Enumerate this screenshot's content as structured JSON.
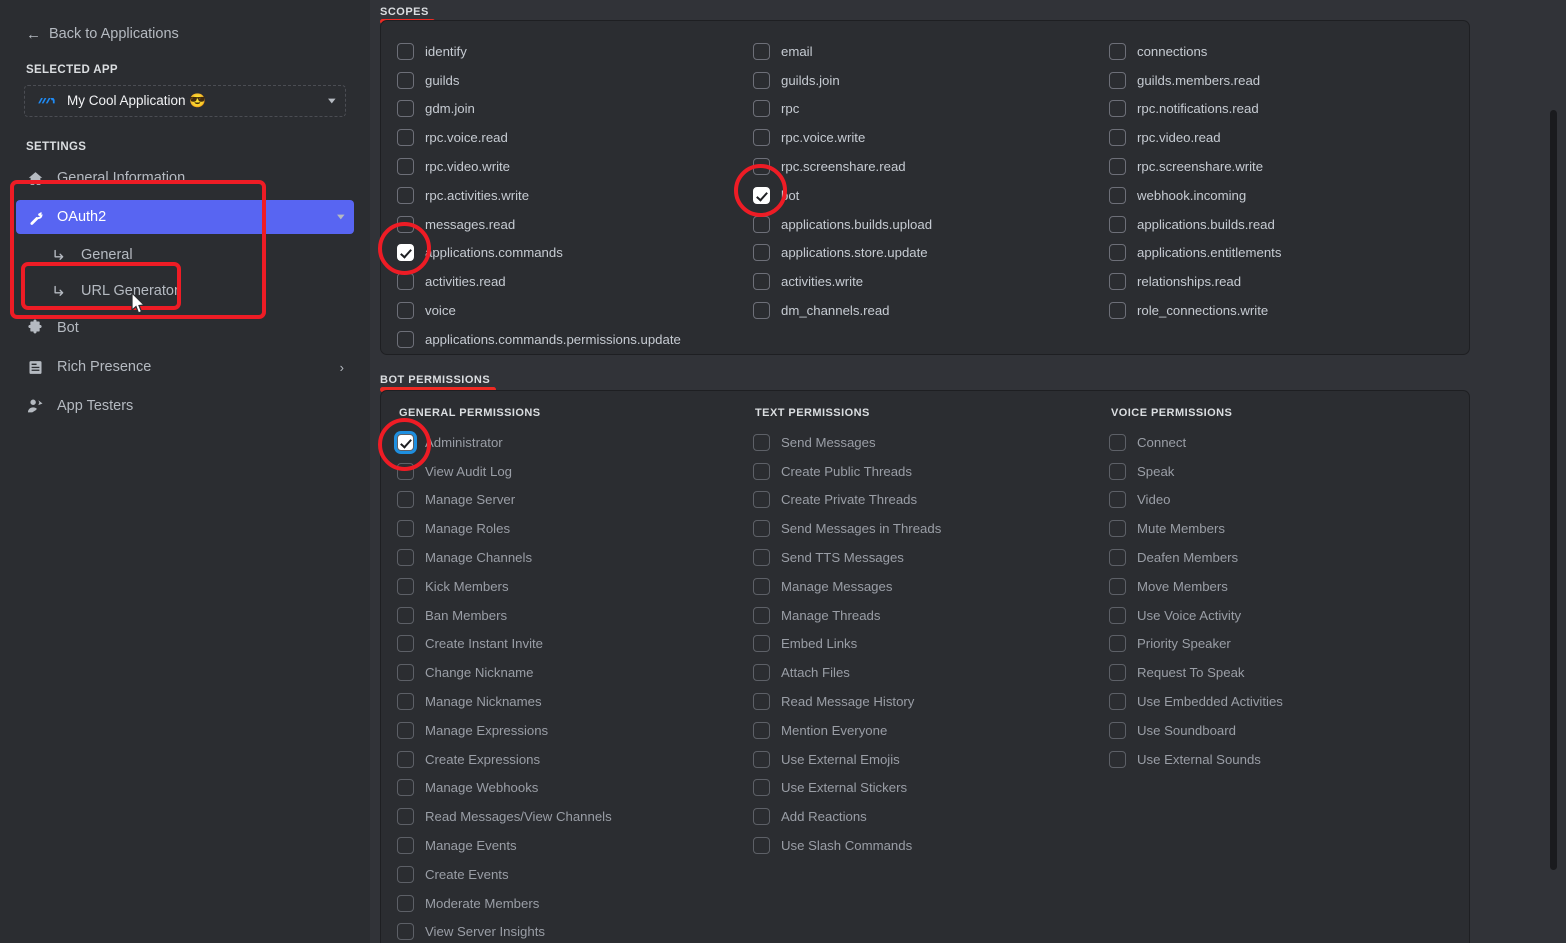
{
  "sidebar": {
    "back_label": "Back to Applications",
    "selected_app_label": "SELECTED APP",
    "app_name": "My Cool Application 😎",
    "settings_label": "SETTINGS",
    "items": [
      {
        "label": "General Information",
        "icon": "home-icon",
        "active": false,
        "has_chevron": false
      },
      {
        "label": "OAuth2",
        "icon": "wrench-icon",
        "active": true,
        "has_chevron": true
      },
      {
        "label": "Bot",
        "icon": "puzzle-icon",
        "active": false,
        "has_chevron": false
      },
      {
        "label": "Rich Presence",
        "icon": "document-icon",
        "active": false,
        "has_chevron": true
      },
      {
        "label": "App Testers",
        "icon": "person-add-icon",
        "active": false,
        "has_chevron": false
      }
    ],
    "oauth_children": [
      {
        "label": "General",
        "icon": "arrow-branch-icon"
      },
      {
        "label": "URL Generator",
        "icon": "arrow-branch-icon"
      }
    ]
  },
  "scopes": {
    "heading": "SCOPES",
    "columns": [
      [
        {
          "label": "identify",
          "checked": false
        },
        {
          "label": "guilds",
          "checked": false
        },
        {
          "label": "gdm.join",
          "checked": false
        },
        {
          "label": "rpc.voice.read",
          "checked": false
        },
        {
          "label": "rpc.video.write",
          "checked": false
        },
        {
          "label": "rpc.activities.write",
          "checked": false
        },
        {
          "label": "messages.read",
          "checked": false
        },
        {
          "label": "applications.commands",
          "checked": true
        },
        {
          "label": "activities.read",
          "checked": false
        },
        {
          "label": "voice",
          "checked": false
        },
        {
          "label": "applications.commands.permissions.update",
          "checked": false
        }
      ],
      [
        {
          "label": "email",
          "checked": false
        },
        {
          "label": "guilds.join",
          "checked": false
        },
        {
          "label": "rpc",
          "checked": false
        },
        {
          "label": "rpc.voice.write",
          "checked": false
        },
        {
          "label": "rpc.screenshare.read",
          "checked": false
        },
        {
          "label": "bot",
          "checked": true
        },
        {
          "label": "applications.builds.upload",
          "checked": false
        },
        {
          "label": "applications.store.update",
          "checked": false
        },
        {
          "label": "activities.write",
          "checked": false
        },
        {
          "label": "dm_channels.read",
          "checked": false
        }
      ],
      [
        {
          "label": "connections",
          "checked": false
        },
        {
          "label": "guilds.members.read",
          "checked": false
        },
        {
          "label": "rpc.notifications.read",
          "checked": false
        },
        {
          "label": "rpc.video.read",
          "checked": false
        },
        {
          "label": "rpc.screenshare.write",
          "checked": false
        },
        {
          "label": "webhook.incoming",
          "checked": false
        },
        {
          "label": "applications.builds.read",
          "checked": false
        },
        {
          "label": "applications.entitlements",
          "checked": false
        },
        {
          "label": "relationships.read",
          "checked": false
        },
        {
          "label": "role_connections.write",
          "checked": false
        }
      ]
    ]
  },
  "bot_permissions": {
    "heading": "BOT PERMISSIONS",
    "groups": [
      {
        "title": "GENERAL PERMISSIONS",
        "items": [
          {
            "label": "Administrator",
            "checked": true,
            "focused": true
          },
          {
            "label": "View Audit Log",
            "checked": false
          },
          {
            "label": "Manage Server",
            "checked": false
          },
          {
            "label": "Manage Roles",
            "checked": false
          },
          {
            "label": "Manage Channels",
            "checked": false
          },
          {
            "label": "Kick Members",
            "checked": false
          },
          {
            "label": "Ban Members",
            "checked": false
          },
          {
            "label": "Create Instant Invite",
            "checked": false
          },
          {
            "label": "Change Nickname",
            "checked": false
          },
          {
            "label": "Manage Nicknames",
            "checked": false
          },
          {
            "label": "Manage Expressions",
            "checked": false
          },
          {
            "label": "Create Expressions",
            "checked": false
          },
          {
            "label": "Manage Webhooks",
            "checked": false
          },
          {
            "label": "Read Messages/View Channels",
            "checked": false
          },
          {
            "label": "Manage Events",
            "checked": false
          },
          {
            "label": "Create Events",
            "checked": false
          },
          {
            "label": "Moderate Members",
            "checked": false
          },
          {
            "label": "View Server Insights",
            "checked": false
          }
        ]
      },
      {
        "title": "TEXT PERMISSIONS",
        "items": [
          {
            "label": "Send Messages",
            "checked": false
          },
          {
            "label": "Create Public Threads",
            "checked": false
          },
          {
            "label": "Create Private Threads",
            "checked": false
          },
          {
            "label": "Send Messages in Threads",
            "checked": false
          },
          {
            "label": "Send TTS Messages",
            "checked": false
          },
          {
            "label": "Manage Messages",
            "checked": false
          },
          {
            "label": "Manage Threads",
            "checked": false
          },
          {
            "label": "Embed Links",
            "checked": false
          },
          {
            "label": "Attach Files",
            "checked": false
          },
          {
            "label": "Read Message History",
            "checked": false
          },
          {
            "label": "Mention Everyone",
            "checked": false
          },
          {
            "label": "Use External Emojis",
            "checked": false
          },
          {
            "label": "Use External Stickers",
            "checked": false
          },
          {
            "label": "Add Reactions",
            "checked": false
          },
          {
            "label": "Use Slash Commands",
            "checked": false
          }
        ]
      },
      {
        "title": "VOICE PERMISSIONS",
        "items": [
          {
            "label": "Connect",
            "checked": false
          },
          {
            "label": "Speak",
            "checked": false
          },
          {
            "label": "Video",
            "checked": false
          },
          {
            "label": "Mute Members",
            "checked": false
          },
          {
            "label": "Deafen Members",
            "checked": false
          },
          {
            "label": "Move Members",
            "checked": false
          },
          {
            "label": "Use Voice Activity",
            "checked": false
          },
          {
            "label": "Priority Speaker",
            "checked": false
          },
          {
            "label": "Request To Speak",
            "checked": false
          },
          {
            "label": "Use Embedded Activities",
            "checked": false
          },
          {
            "label": "Use Soundboard",
            "checked": false
          },
          {
            "label": "Use External Sounds",
            "checked": false
          }
        ]
      }
    ]
  },
  "colors": {
    "accent": "#5865f2",
    "annotation_red": "#ee1c25",
    "focus_blue": "#1e8fe0",
    "panel_bg": "#2b2d31",
    "main_bg": "#313338"
  }
}
